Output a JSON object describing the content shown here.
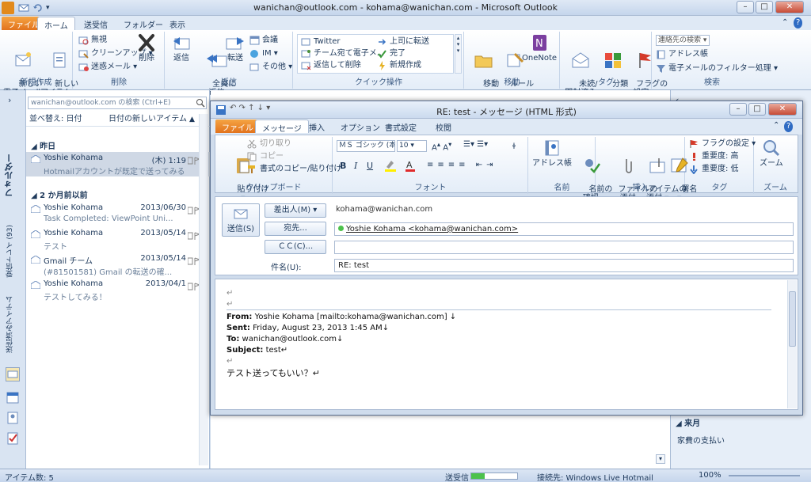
{
  "window": {
    "title": "wanichan@outlook.com - kohama@wanichan.com - Microsoft Outlook",
    "min": "–",
    "max": "□",
    "close": "✕"
  },
  "tabs": [
    {
      "label": "ファイル"
    },
    {
      "label": "ホーム"
    },
    {
      "label": "送受信"
    },
    {
      "label": "フォルダー"
    },
    {
      "label": "表示"
    }
  ],
  "ribbon": {
    "new": {
      "new_mail": "新しい\n電子メール",
      "new_items": "新しい\nアイテム ▾",
      "label": "新規作成"
    },
    "delete": {
      "ignore": "無視",
      "cleanup": "クリーンアップ ▾",
      "junk": "迷惑メール ▾",
      "delete": "削除",
      "label": "削除"
    },
    "respond": {
      "reply": "返信",
      "reply_all": "全員に\n返信",
      "forward": "転送",
      "meeting": "会議",
      "im": "IM ▾",
      "more": "その他 ▾",
      "label": "返信"
    },
    "quicksteps": {
      "items": [
        "Twitter",
        "チーム宛て電子メ...",
        "返信して削除",
        "上司に転送",
        "完了",
        "新規作成"
      ],
      "label": "クイック操作"
    },
    "move": {
      "move": "移動\n▾",
      "rules": "ルール\n▾",
      "onenote": "OneNote",
      "label": "移動"
    },
    "tags": {
      "unread": "未読/\n開封済み",
      "categorize": "分類\n▾",
      "flag": "フラグの\n設定 ▾",
      "label": "タグ"
    },
    "find": {
      "search_contacts": "連絡先の検索",
      "address_book": "アドレス帳",
      "filter": "電子メールのフィルター処理 ▾",
      "label": "検索"
    }
  },
  "nav": {
    "folder_label": "フォルダー",
    "inbox": "受信トレイ (93)",
    "sent": "送信済みアイテム"
  },
  "list": {
    "search_placeholder": "wanichan@outlook.com の検索 (Ctrl+E)",
    "sort_by": "並べ替え: 日付",
    "sort_order": "日付の新しいアイテム",
    "group_yesterday": "昨日",
    "group_old": "2 か月前以前",
    "items": [
      {
        "from": "Yoshie Kohama",
        "date": "(木) 1:19",
        "preview": "Hotmailアカウントが既定で送ってみる"
      },
      {
        "from": "Yoshie Kohama",
        "date": "2013/06/30",
        "preview": "Task Completed: ViewPoint Uni..."
      },
      {
        "from": "Yoshie Kohama",
        "date": "2013/05/14",
        "preview": "テスト"
      },
      {
        "from": "Gmail チーム",
        "date": "2013/05/14",
        "preview": "(#81501581) Gmail の転送の確..."
      },
      {
        "from": "Yoshie Kohama",
        "date": "2013/04/1",
        "preview": "テストしてみる！"
      }
    ]
  },
  "todo": {
    "group": "来月",
    "item": "家費の支払い"
  },
  "status": {
    "items": "アイテム数: 5",
    "sendrecv": "送受信",
    "connection": "接続先: Windows Live Hotmail",
    "zoom": "100%",
    "progress": 0.3
  },
  "msg": {
    "title": "RE: test - メッセージ (HTML 形式)",
    "tabs": [
      {
        "label": "ファイル"
      },
      {
        "label": "メッセージ"
      },
      {
        "label": "挿入"
      },
      {
        "label": "オプション"
      },
      {
        "label": "書式設定"
      },
      {
        "label": "校閲"
      }
    ],
    "clipboard": {
      "paste": "貼り付け\n▾",
      "cut": "切り取り",
      "copy": "コピー",
      "format_painter": "書式のコピー/貼り付け",
      "label": "クリップボード"
    },
    "font": {
      "name": "ＭＳ ゴシック (本",
      "size": "10",
      "label": "フォント"
    },
    "names": {
      "address_book": "アドレス帳",
      "check_names": "名前の\n確認",
      "label": "名前"
    },
    "include": {
      "attach_file": "ファイルの\n添付",
      "attach_item": "アイテムの\n添付 ▾",
      "signature": "署名\n▾",
      "label": "挿入"
    },
    "tags": {
      "followup": "フラグの設定 ▾",
      "high": "重要度: 高",
      "low": "重要度: 低",
      "label": "タグ"
    },
    "zoom": {
      "zoom": "ズーム",
      "label": "ズーム"
    },
    "send": "送信(S)",
    "from_btn": "差出人(M) ▾",
    "from_value": "kohama@wanichan.com",
    "to_btn": "宛先...",
    "to_value": "Yoshie Kohama <kohama@wanichan.com>",
    "cc_btn": "ＣＣ(C)...",
    "cc_value": "",
    "subject_label": "件名(U):",
    "subject_value": "RE: test",
    "body": {
      "from_label": "From:",
      "from_value": " Yoshie Kohama [mailto:kohama@wanichan.com] ↓",
      "sent_label": "Sent:",
      "sent_value": " Friday, August 23, 2013 1:45 AM↓",
      "to_label": "To:",
      "to_value": " wanichan@outlook.com↓",
      "subject_label": "Subject:",
      "subject_value": " test↵",
      "text": "テスト送ってもいい？↵",
      "para": "↵"
    }
  }
}
